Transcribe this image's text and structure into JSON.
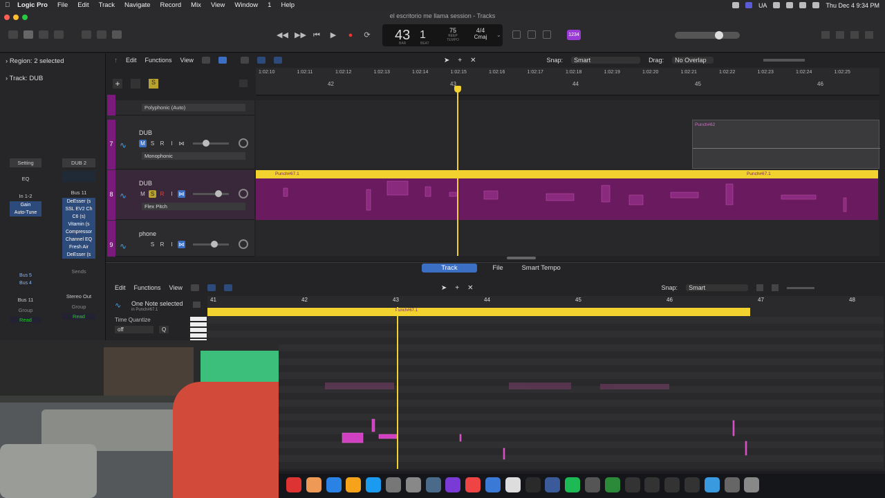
{
  "menubar": {
    "app": "Logic Pro",
    "items": [
      "File",
      "Edit",
      "Track",
      "Navigate",
      "Record",
      "Mix",
      "View",
      "Window",
      "1",
      "Help"
    ],
    "input_source": "UA",
    "clock": "Thu Dec 4  9:34 PM"
  },
  "window_title": "el escritorio me llama session - Tracks",
  "lcd": {
    "bar": "43",
    "beat": "1",
    "bar_label": "BAR",
    "beat_label": "BEAT",
    "tempo": "75",
    "tempo_mode": "KEEP",
    "tempo_label": "TEMPO",
    "signature": "4/4",
    "key": "Cmaj"
  },
  "badge": "1234",
  "inspector": {
    "region": "Region: 2 selected",
    "track": "Track: DUB",
    "left_strip": {
      "setting": "Setting",
      "eq": "EQ",
      "io": "In 1-2",
      "plugins": [
        "Gain",
        "Auto-Tune"
      ],
      "sends": [
        "Bus 5",
        "Bus 4"
      ],
      "output": "Bus 11",
      "group": "Group",
      "automation": "Read"
    },
    "right_strip": {
      "name": "DUB 2",
      "io": "Bus 11",
      "plugins": [
        "DeEsser (s",
        "SSL EV2 Ch",
        "C6 (s)",
        "Vitamin (s",
        "Compressor",
        "Channel EQ",
        "Fresh Air",
        "DeEsser (s"
      ],
      "sends": "Sends",
      "output": "Stereo Out",
      "group": "Group",
      "automation": "Read"
    }
  },
  "tracks_toolbar": {
    "edit": "Edit",
    "functions": "Functions",
    "view": "View",
    "snap_label": "Snap:",
    "snap_value": "Smart",
    "drag_label": "Drag:",
    "drag_value": "No Overlap"
  },
  "tracks": [
    {
      "num": "",
      "name": "",
      "mode": "Polyphonic (Auto)"
    },
    {
      "num": "7",
      "name": "DUB",
      "mode": "Monophonic"
    },
    {
      "num": "8",
      "name": "DUB",
      "mode": "Flex Pitch"
    },
    {
      "num": "9",
      "name": "phone",
      "mode": ""
    }
  ],
  "ruler": {
    "bars": [
      "42",
      "43",
      "44",
      "45",
      "46"
    ],
    "times": [
      "1:02:10",
      "1:02:11",
      "1:02:12",
      "1:02:13",
      "1:02:14",
      "1:02:15",
      "1:02:16",
      "1:02:17",
      "1:02:18",
      "1:02:19",
      "1:02:20",
      "1:02:21",
      "1:02:22",
      "1:02:23",
      "1:02:24",
      "1:02:25"
    ]
  },
  "regions": {
    "punch62": "Punch#62",
    "punch67_a": "Punch#67.1",
    "punch67_b": "Punch#67.1"
  },
  "bottom_tabs": [
    "Track",
    "File",
    "Smart Tempo"
  ],
  "editor": {
    "edit": "Edit",
    "functions": "Functions",
    "view": "View",
    "snap_label": "Snap:",
    "snap_value": "Smart",
    "selection": "One Note selected",
    "selection_sub": "in Punch#67.1",
    "time_quantize": "Time Quantize",
    "tq_value": "off",
    "q": "Q",
    "bars": [
      "41",
      "42",
      "43",
      "44",
      "45",
      "46",
      "47",
      "48"
    ],
    "region": "Punch#67.1"
  },
  "colors": {
    "accent": "#3a6fc4",
    "region_yellow": "#f2d22e",
    "region_magenta": "#6a1a5e",
    "track_num": "#7a1a7a"
  }
}
